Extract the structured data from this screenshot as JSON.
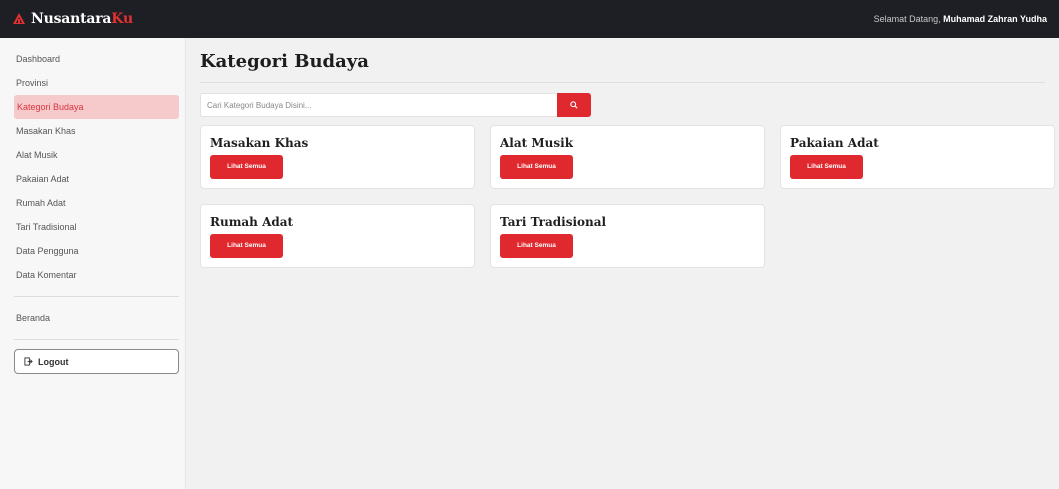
{
  "header": {
    "brand_main": "Nusantara",
    "brand_accent": "Ku",
    "welcome_prefix": "Selamat Datang,",
    "user_name": "Muhamad Zahran Yudha"
  },
  "sidebar": {
    "items": [
      {
        "label": "Dashboard",
        "active": false
      },
      {
        "label": "Provinsi",
        "active": false
      },
      {
        "label": "Kategori Budaya",
        "active": true
      },
      {
        "label": "Masakan Khas",
        "active": false
      },
      {
        "label": "Alat Musik",
        "active": false
      },
      {
        "label": "Pakaian Adat",
        "active": false
      },
      {
        "label": "Rumah Adat",
        "active": false
      },
      {
        "label": "Tari Tradisional",
        "active": false
      },
      {
        "label": "Data Pengguna",
        "active": false
      },
      {
        "label": "Data Komentar",
        "active": false
      }
    ],
    "secondary": "Beranda",
    "logout_label": "Logout"
  },
  "main": {
    "title": "Kategori Budaya",
    "search_placeholder": "Cari Kategori Budaya Disini...",
    "search_value": "",
    "cards": [
      {
        "title": "Masakan Khas",
        "button": "Lihat Semua"
      },
      {
        "title": "Alat Musik",
        "button": "Lihat Semua"
      },
      {
        "title": "Pakaian Adat",
        "button": "Lihat Semua"
      },
      {
        "title": "Rumah Adat",
        "button": "Lihat Semua"
      },
      {
        "title": "Tari Tradisional",
        "button": "Lihat Semua"
      }
    ]
  },
  "colors": {
    "accent": "#e0292f",
    "active_bg": "#f6c9cb",
    "topbar": "#1e1f24"
  },
  "icons": {
    "brand": "temple-logo-icon",
    "search": "search-icon",
    "logout": "logout-icon"
  }
}
